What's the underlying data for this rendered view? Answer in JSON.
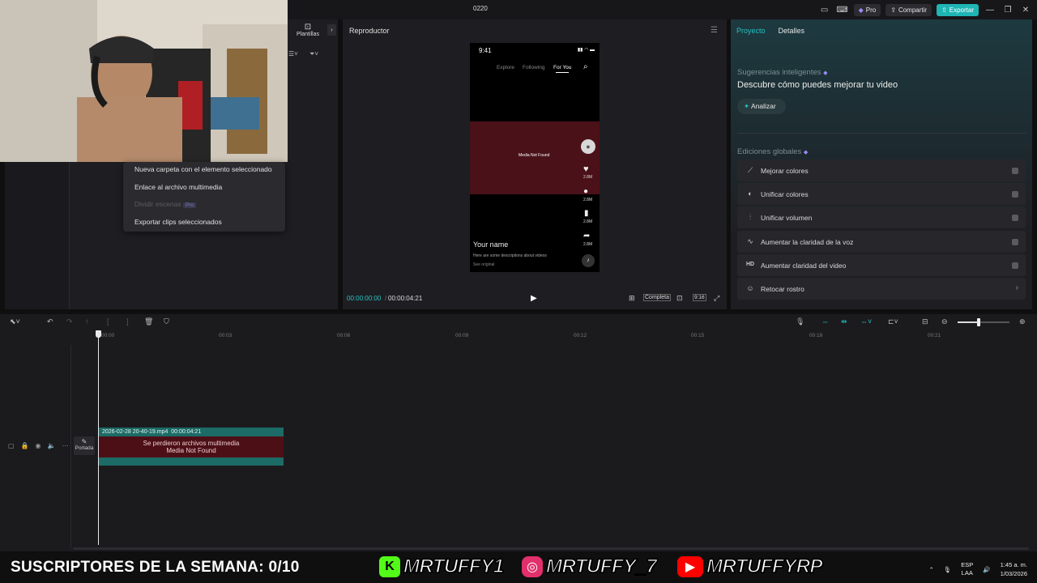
{
  "titlebar": {
    "project_name": "0220",
    "pro_label": "Pro",
    "share_label": "Compartir",
    "export_label": "Exportar"
  },
  "media_panel": {
    "templates_label": "Plantillas"
  },
  "context_menu": {
    "items": [
      {
        "label": "Nueva carpeta con el elemento seleccionado",
        "enabled": true
      },
      {
        "label": "Enlace al archivo multimedia",
        "enabled": true
      },
      {
        "label": "Dividir escenas",
        "badge": "Pro",
        "enabled": false
      },
      {
        "label": "Exportar clips seleccionados",
        "enabled": true
      }
    ]
  },
  "player": {
    "title": "Reproductor",
    "current_time": "00:00:00:00",
    "total_time": "00:00:04:21",
    "ratio_label": "Completa",
    "aspect_label": "9:16",
    "phone": {
      "status_time": "9:41",
      "nav": [
        "Explore",
        "Following",
        "For You"
      ],
      "media_text": "Media Not Found",
      "counts": [
        "2.8M",
        "2.8M",
        "2.8M",
        "2.8M"
      ],
      "username": "Your name",
      "description": "Here are some descriptions about videos",
      "see_original": "See original"
    }
  },
  "right_panel": {
    "tabs": [
      "Proyecto",
      "Detalles"
    ],
    "smart_title": "Sugerencias inteligentes",
    "smart_heading": "Descubre cómo puedes mejorar tu video",
    "analyze_label": "Analizar",
    "global_title": "Ediciones globales",
    "edits": [
      {
        "label": "Mejorar colores",
        "icon": "wand-icon"
      },
      {
        "label": "Unificar colores",
        "icon": "palette-icon"
      },
      {
        "label": "Unificar volumen",
        "icon": "sliders-icon"
      },
      {
        "label": "Aumentar la claridad de la voz",
        "icon": "voice-icon"
      },
      {
        "label": "Aumentar claridad del video",
        "icon": "hd-icon"
      },
      {
        "label": "Retocar rostro",
        "icon": "face-icon"
      }
    ]
  },
  "timeline": {
    "ruler": [
      "00:00",
      "00:03",
      "00:06",
      "00:09",
      "00:12",
      "00:15",
      "00:18",
      "00:21"
    ],
    "cover_label": "Portada",
    "clip": {
      "filename": "2026-02-28 20-40-19.mp4",
      "duration": "00:00:04:21",
      "error_line1": "Se perdieron archivos multimedia",
      "error_line2": "Media Not Found"
    }
  },
  "stream_overlay": {
    "subs_text": "SUSCRIPTORES DE LA SEMANA: 0/10",
    "kick": "MRTUFFY1",
    "instagram": "MRTUFFY_7",
    "youtube": "MRTUFFYRP"
  },
  "taskbar": {
    "lang1": "ESP",
    "lang2": "LAA",
    "time": "1:45 a. m.",
    "date": "1/03/2026"
  }
}
